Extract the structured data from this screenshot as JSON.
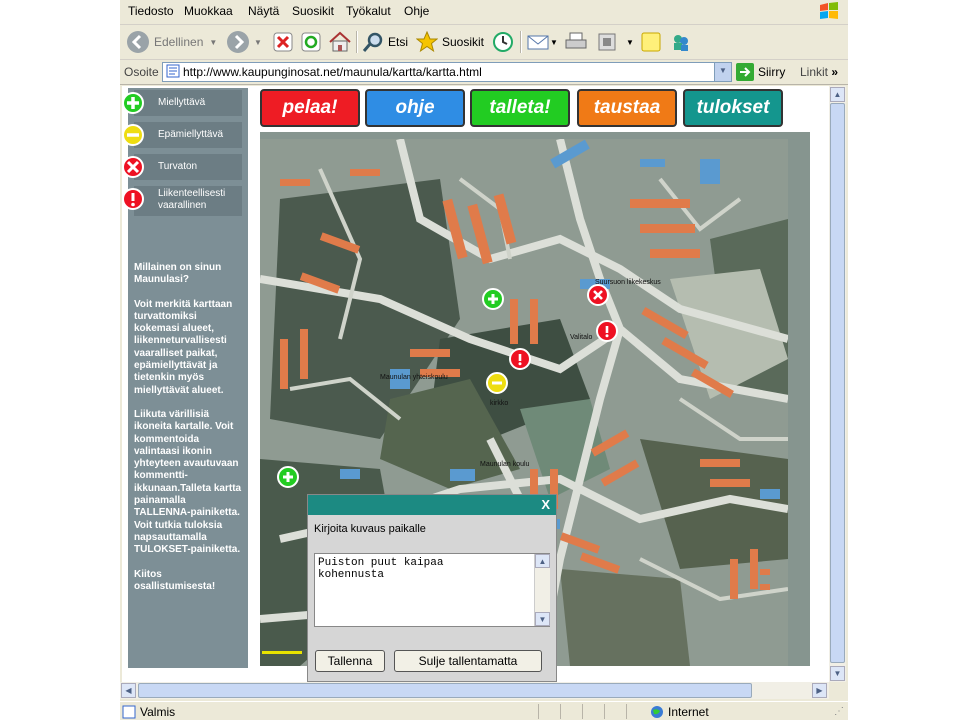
{
  "menu": {
    "items": [
      "Tiedosto",
      "Muokkaa",
      "Näytä",
      "Suosikit",
      "Työkalut",
      "Ohje"
    ]
  },
  "toolbar": {
    "back": "Edellinen",
    "search": "Etsi",
    "favorites": "Suosikit"
  },
  "address": {
    "label": "Osoite",
    "url": "http://www.kaupunginosat.net/maunula/kartta/kartta.html",
    "go": "Siirry",
    "links": "Linkit"
  },
  "legend": [
    {
      "label": "Miellyttävä",
      "icon": "plus-icon",
      "color": "#22cc22"
    },
    {
      "label": "Epämiellyttävä",
      "icon": "minus-icon",
      "color": "#eedd11"
    },
    {
      "label": "Turvaton",
      "icon": "x-icon",
      "color": "#ee1122"
    },
    {
      "label": "Liikenteellisesti vaarallinen",
      "icon": "exclamation-icon",
      "color": "#ee1122"
    }
  ],
  "sidebar": {
    "p1": "Millainen on sinun Maunulasi?",
    "p2": "Voit merkitä karttaan turvattomiksi kokemasi alueet, liikenneturvallisesti vaaralliset paikat, epämiellyttävät ja tietenkin myös miellyttävät alueet.",
    "p3": "Liikuta värillisiä ikoneita kartalle. Voit kommentoida valintaasi ikonin yhteyteen avautuvaan kommentti-ikkunaan.Talleta kartta painamalla TALLENNA-painiketta. Voit tutkia tuloksia napsauttamalla TULOKSET-painiketta.",
    "p4": "Kiitos osallistumisesta!"
  },
  "tabs": [
    {
      "label": "pelaa!",
      "color": "#ee1c24"
    },
    {
      "label": "ohje",
      "color": "#2f8de4"
    },
    {
      "label": "talleta!",
      "color": "#22cc22"
    },
    {
      "label": "taustaa",
      "color": "#f07a16"
    },
    {
      "label": "tulokset",
      "color": "#14968e"
    }
  ],
  "map": {
    "labels": [
      "Suursuon liikekeskus",
      "Valitalo",
      "Maunulan yhteiskoulu",
      "kirkko",
      "Maunulan koulu"
    ]
  },
  "dialog": {
    "close": "X",
    "title": "Kirjoita kuvaus paikalle",
    "text": "Puiston puut kaipaa\nkohennusta",
    "save": "Tallenna",
    "close_nosave": "Sulje tallentamatta"
  },
  "status": {
    "left": "Valmis",
    "zone": "Internet"
  }
}
